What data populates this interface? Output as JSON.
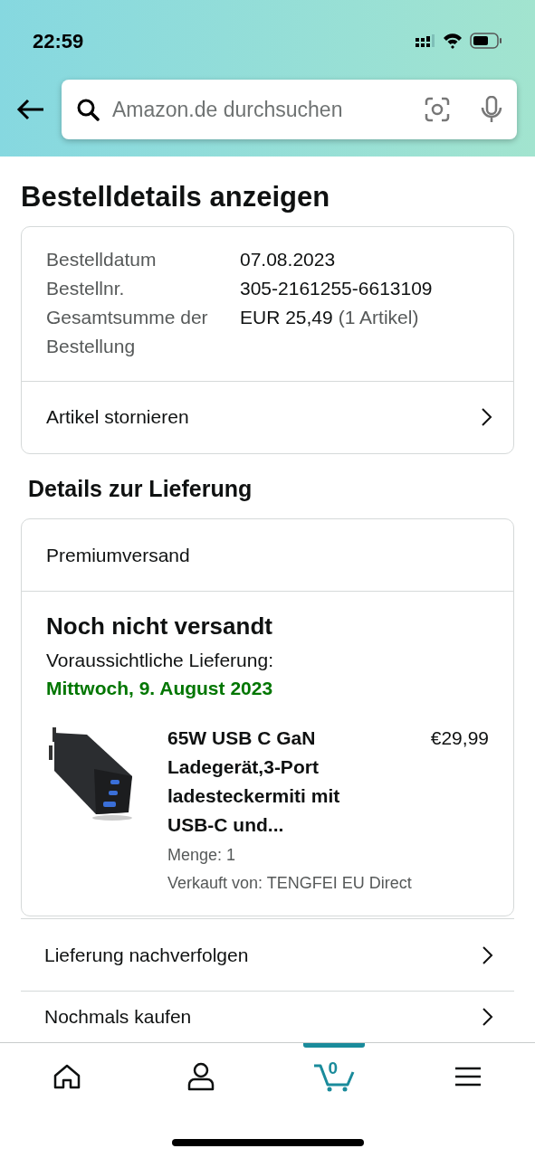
{
  "status_bar": {
    "time": "22:59"
  },
  "search": {
    "placeholder": "Amazon.de durchsuchen"
  },
  "title": "Bestelldetails anzeigen",
  "order_summary": {
    "fields": [
      {
        "label": "Bestelldatum",
        "value": "07.08.2023"
      },
      {
        "label": "Bestellnr.",
        "value": "305-2161255-6613109"
      },
      {
        "label": "Gesamtsumme der Bestellung",
        "value": "EUR 25,49",
        "note": "(1 Artikel)"
      }
    ],
    "action": "Artikel stornieren"
  },
  "delivery_heading": "Details zur Lieferung",
  "shipment": {
    "shipping_method": "Premiumversand",
    "status": "Noch nicht versandt",
    "eta_label": "Voraussichtliche Lieferung:",
    "eta_date": "Mittwoch, 9. August 2023",
    "item": {
      "kind": "picture",
      "title": "65W USB C GaN Ladegerät,3-Port ladesteckermiti mit USB-C und...",
      "price": "€29,99",
      "quantity": "Menge: 1",
      "seller": "Verkauft von: TENGFEI EU Direct"
    }
  },
  "links": [
    "Lieferung nachverfolgen",
    "Nochmals kaufen"
  ],
  "nav_items": [
    {
      "kind": "home",
      "selected": false
    },
    {
      "kind": "account",
      "selected": false
    },
    {
      "kind": "cart",
      "selected": true,
      "badge": "0"
    },
    {
      "kind": "menu",
      "selected": false
    }
  ]
}
